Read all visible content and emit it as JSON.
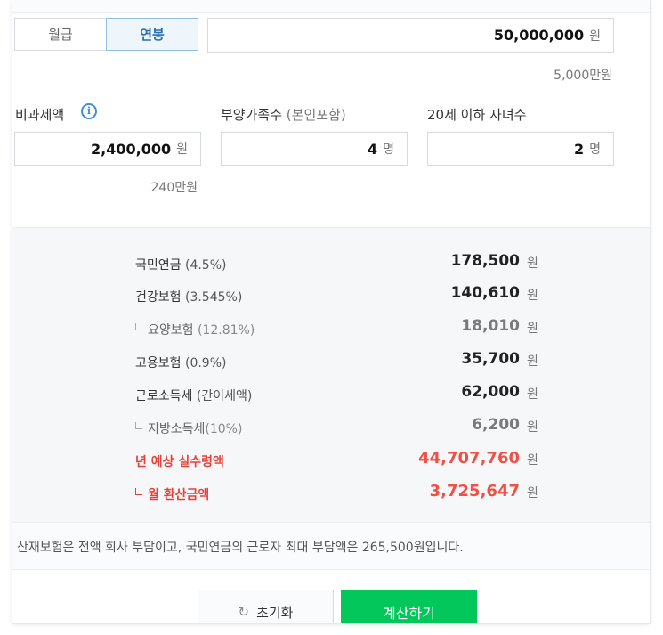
{
  "tabs": [
    {
      "label": "월급",
      "active": false
    },
    {
      "label": "연봉",
      "active": true
    }
  ],
  "salary": {
    "value": "50,000,000",
    "unit": "원",
    "hint": "5,000만원"
  },
  "nontax": {
    "label": "비과세액",
    "value": "2,400,000",
    "unit": "원",
    "hint": "240만원",
    "info_icon": "i"
  },
  "dependents": {
    "label": "부양가족수",
    "sub": "(본인포함)",
    "value": "4",
    "unit": "명"
  },
  "children": {
    "label": "20세 이하 자녀수",
    "value": "2",
    "unit": "명"
  },
  "results": [
    {
      "label": "국민연금",
      "pct": "(4.5%)",
      "amount": "178,500",
      "unit": "원",
      "style": "main"
    },
    {
      "label": "건강보험",
      "pct": "(3.545%)",
      "amount": "140,610",
      "unit": "원",
      "style": "main"
    },
    {
      "label": "요양보험",
      "pct": "(12.81%)",
      "amount": "18,010",
      "unit": "원",
      "style": "sub"
    },
    {
      "label": "고용보험",
      "pct": "(0.9%)",
      "amount": "35,700",
      "unit": "원",
      "style": "main"
    },
    {
      "label": "근로소득세",
      "pct": "(간이세액)",
      "amount": "62,000",
      "unit": "원",
      "style": "main"
    },
    {
      "label": "지방소득세",
      "pct": "(10%)",
      "amount": "6,200",
      "unit": "원",
      "style": "sub"
    },
    {
      "label": "년 예상 실수령액",
      "pct": "",
      "amount": "44,707,760",
      "unit": "원",
      "style": "red"
    },
    {
      "label": "월 환산금액",
      "pct": "",
      "amount": "3,725,647",
      "unit": "원",
      "style": "red-sub"
    }
  ],
  "notice": "산재보험은 전액 회사 부담이고, 국민연금의 근로자 최대 부담액은 265,500원입니다.",
  "buttons": {
    "reset_label": "초기화",
    "reset_icon": "↻",
    "calc_label": "계산하기"
  },
  "colors": {
    "accent_blue": "#2b6fb5",
    "red": "#f05046",
    "green": "#03c75a"
  }
}
